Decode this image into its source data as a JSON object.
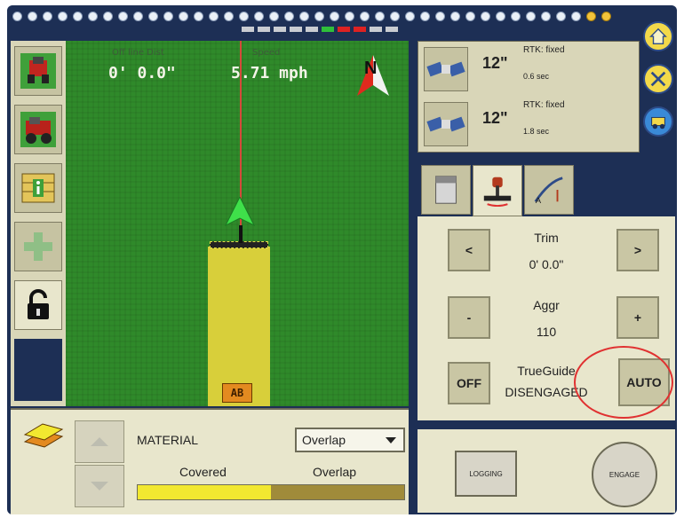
{
  "top": {
    "dot_count": 40,
    "warning_dots": 2
  },
  "left_nav": {
    "buttons": [
      {
        "name": "tractor-view-button",
        "icon": "tractor-icon"
      },
      {
        "name": "vehicle-setup-button",
        "icon": "truck-icon"
      },
      {
        "name": "field-info-button",
        "icon": "info-icon"
      },
      {
        "name": "add-button",
        "icon": "plus-icon"
      },
      {
        "name": "lock-button",
        "icon": "unlock-icon"
      }
    ]
  },
  "map": {
    "offline_label": "Off line Dist",
    "offline_value": "0' 0.0\"",
    "speed_label": "Speed",
    "speed_value": "5.71 mph",
    "compass_letter": "N",
    "ab_label": "AB"
  },
  "gps": {
    "rows": [
      {
        "value": "12\"",
        "status": "RTK: fixed",
        "age": "0.6 sec"
      },
      {
        "value": "12\"",
        "status": "RTK: fixed",
        "age": "1.8 sec"
      }
    ]
  },
  "side_icons": [
    {
      "name": "home-icon"
    },
    {
      "name": "tools-icon"
    },
    {
      "name": "vehicle-icon"
    }
  ],
  "tabs": [
    {
      "name": "tab-notes",
      "icon": "document-icon"
    },
    {
      "name": "tab-implement",
      "icon": "implement-icon",
      "active": true
    },
    {
      "name": "tab-guidance",
      "icon": "guidance-icon"
    }
  ],
  "panel": {
    "trim_label": "Trim",
    "trim_value": "0' 0.0\"",
    "trim_left": "<",
    "trim_right": ">",
    "aggr_label": "Aggr",
    "aggr_value": "110",
    "aggr_minus": "-",
    "aggr_plus": "+",
    "off_label": "OFF",
    "trueguide_label": "TrueGuide",
    "trueguide_state": "DISENGAGED",
    "auto_label": "AUTO"
  },
  "bottom": {
    "material_label": "MATERIAL",
    "dropdown_value": "Overlap",
    "covered_label": "Covered",
    "overlap_label": "Overlap",
    "coverage_fraction": 0.5
  },
  "actions": {
    "logging_label": "LOGGING",
    "engage_label": "ENGAGE"
  },
  "colors": {
    "frame": "#1d2f55",
    "field": "#2f8a2a",
    "panel": "#e8e6cc",
    "accent_red": "#e03131"
  }
}
